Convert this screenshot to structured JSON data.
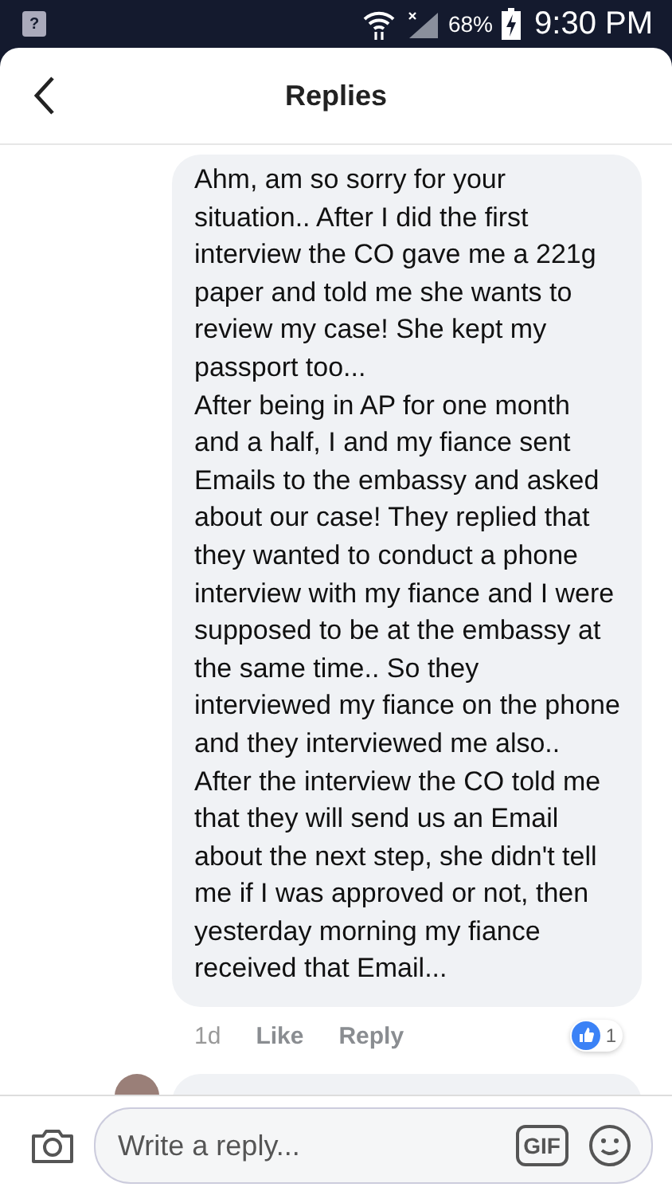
{
  "status_bar": {
    "notification_glyph": "?",
    "battery": "68%",
    "time": "9:30 PM"
  },
  "header": {
    "title": "Replies"
  },
  "comment": {
    "paragraphs": [
      "Ahm, am so sorry for your situation.. After I did the first interview the CO gave me a 221g paper and told me she wants to review my case!  She kept my passport too...",
      "After being in AP for one month and a half, I and my fiance sent Emails to the embassy and asked about our case!  They replied that they wanted to conduct a phone interview with my fiance and I were supposed to be at the embassy at the same time.. So they interviewed my fiance on the phone and they interviewed me also.. After the interview the CO told me that they will send us an Email about the next step, she didn't tell me if I was approved or not, then yesterday morning my fiance received that Email..."
    ],
    "time": "1d",
    "actions": [
      "Like",
      "Reply"
    ],
    "reaction_count": "1"
  },
  "reply_bar": {
    "placeholder": "Write a reply...",
    "gif_label": "GIF"
  }
}
